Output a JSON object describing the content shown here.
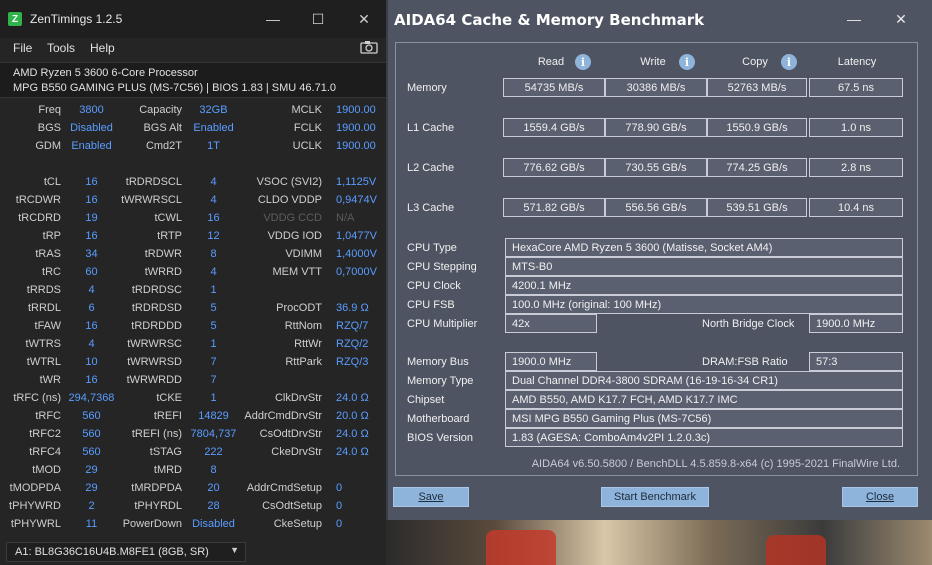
{
  "zen": {
    "title": "ZenTimings 1.2.5",
    "logo": "Z",
    "menu": [
      "File",
      "Tools",
      "Help"
    ],
    "cpu": "AMD Ryzen 5 3600 6-Core Processor",
    "board": "MPG B550 GAMING PLUS (MS-7C56) | BIOS 1.83 | SMU 46.71.0",
    "rows": [
      [
        "Freq",
        "3800",
        "Capacity",
        "32GB",
        "MCLK",
        "1900.00"
      ],
      [
        "BGS",
        "Disabled",
        "BGS Alt",
        "Enabled",
        "FCLK",
        "1900.00"
      ],
      [
        "GDM",
        "Enabled",
        "Cmd2T",
        "1T",
        "UCLK",
        "1900.00"
      ],
      [
        "",
        "",
        "",
        "",
        "",
        ""
      ],
      [
        "tCL",
        "16",
        "tRDRDSCL",
        "4",
        "VSOC (SVI2)",
        "1,1125V"
      ],
      [
        "tRCDWR",
        "16",
        "tWRWRSCL",
        "4",
        "CLDO VDDP",
        "0,9474V"
      ],
      [
        "tRCDRD",
        "19",
        "tCWL",
        "16",
        "VDDG CCD",
        "N/A"
      ],
      [
        "tRP",
        "16",
        "tRTP",
        "12",
        "VDDG IOD",
        "1,0477V"
      ],
      [
        "tRAS",
        "34",
        "tRDWR",
        "8",
        "VDIMM",
        "1,4000V"
      ],
      [
        "tRC",
        "60",
        "tWRRD",
        "4",
        "MEM VTT",
        "0,7000V"
      ],
      [
        "tRRDS",
        "4",
        "tRDRDSC",
        "1",
        "",
        ""
      ],
      [
        "tRRDL",
        "6",
        "tRDRDSD",
        "5",
        "ProcODT",
        "36.9 Ω"
      ],
      [
        "tFAW",
        "16",
        "tRDRDDD",
        "5",
        "RttNom",
        "RZQ/7"
      ],
      [
        "tWTRS",
        "4",
        "tWRWRSC",
        "1",
        "RttWr",
        "RZQ/2"
      ],
      [
        "tWTRL",
        "10",
        "tWRWRSD",
        "7",
        "RttPark",
        "RZQ/3"
      ],
      [
        "tWR",
        "16",
        "tWRWRDD",
        "7",
        "",
        ""
      ],
      [
        "tRFC (ns)",
        "294,7368",
        "tCKE",
        "1",
        "ClkDrvStr",
        "24.0 Ω"
      ],
      [
        "tRFC",
        "560",
        "tREFI",
        "14829",
        "AddrCmdDrvStr",
        "20.0 Ω"
      ],
      [
        "tRFC2",
        "560",
        "tREFI (ns)",
        "7804,737",
        "CsOdtDrvStr",
        "24.0 Ω"
      ],
      [
        "tRFC4",
        "560",
        "tSTAG",
        "222",
        "CkeDrvStr",
        "24.0 Ω"
      ],
      [
        "tMOD",
        "29",
        "tMRD",
        "8",
        "",
        ""
      ],
      [
        "tMODPDA",
        "29",
        "tMRDPDA",
        "20",
        "AddrCmdSetup",
        "0"
      ],
      [
        "tPHYWRD",
        "2",
        "tPHYRDL",
        "28",
        "CsOdtSetup",
        "0"
      ],
      [
        "tPHYWRL",
        "11",
        "PowerDown",
        "Disabled",
        "CkeSetup",
        "0"
      ]
    ],
    "dimm": "A1: BL8G36C16U4B.M8FE1 (8GB, SR)"
  },
  "aida": {
    "title": "AIDA64 Cache & Memory Benchmark",
    "headers": {
      "read": "Read",
      "write": "Write",
      "copy": "Copy",
      "latency": "Latency"
    },
    "bench": [
      {
        "label": "Memory",
        "read": "54735 MB/s",
        "write": "30386 MB/s",
        "copy": "52763 MB/s",
        "latency": "67.5 ns"
      },
      {
        "label": "L1 Cache",
        "read": "1559.4 GB/s",
        "write": "778.90 GB/s",
        "copy": "1550.9 GB/s",
        "latency": "1.0 ns"
      },
      {
        "label": "L2 Cache",
        "read": "776.62 GB/s",
        "write": "730.55 GB/s",
        "copy": "774.25 GB/s",
        "latency": "2.8 ns"
      },
      {
        "label": "L3 Cache",
        "read": "571.82 GB/s",
        "write": "556.56 GB/s",
        "copy": "539.51 GB/s",
        "latency": "10.4 ns"
      }
    ],
    "cpu_type_label": "CPU Type",
    "cpu_type": "HexaCore AMD Ryzen 5 3600  (Matisse, Socket AM4)",
    "cpu_stepping_label": "CPU Stepping",
    "cpu_stepping": "MTS-B0",
    "cpu_clock_label": "CPU Clock",
    "cpu_clock": "4200.1 MHz",
    "cpu_fsb_label": "CPU FSB",
    "cpu_fsb": "100.0 MHz  (original: 100 MHz)",
    "cpu_mult_label": "CPU Multiplier",
    "cpu_mult": "42x",
    "nb_clock_label": "North Bridge Clock",
    "nb_clock": "1900.0 MHz",
    "mem_bus_label": "Memory Bus",
    "mem_bus": "1900.0 MHz",
    "dram_fsb_label": "DRAM:FSB Ratio",
    "dram_fsb": "57:3",
    "mem_type_label": "Memory Type",
    "mem_type": "Dual Channel DDR4-3800 SDRAM  (16-19-16-34 CR1)",
    "chipset_label": "Chipset",
    "chipset": "AMD B550, AMD K17.7 FCH, AMD K17.7 IMC",
    "mobo_label": "Motherboard",
    "mobo": "MSI MPG B550 Gaming Plus (MS-7C56)",
    "bios_label": "BIOS Version",
    "bios": "1.83  (AGESA: ComboAm4v2PI 1.2.0.3c)",
    "footer": "AIDA64 v6.50.5800 / BenchDLL 4.5.859.8-x64  (c) 1995-2021 FinalWire Ltd.",
    "buttons": {
      "save": "Save",
      "start": "Start Benchmark",
      "close": "Close"
    },
    "accent": "#8fb4dc"
  }
}
